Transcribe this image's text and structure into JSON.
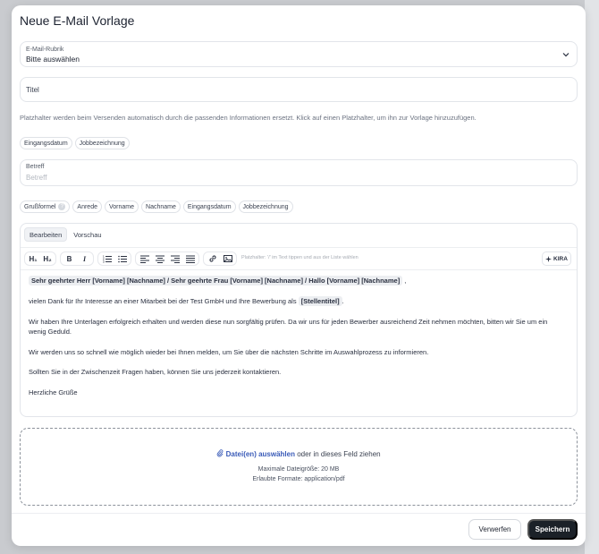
{
  "modal": {
    "title": "Neue E-Mail Vorlage"
  },
  "category": {
    "label": "E-Mail-Rubrik",
    "value": "Bitte auswählen"
  },
  "title_field": {
    "placeholder": "Titel"
  },
  "hint": "Platzhalter werden beim Versenden automatisch durch die passenden Informationen ersetzt. Klick auf einen Platzhalter, um ihn zur Vorlage hinzuzufügen.",
  "subject_placeholders": [
    "Eingangsdatum",
    "Jobbezeichnung"
  ],
  "subject": {
    "label": "Betreff",
    "placeholder": "Betreff"
  },
  "body_placeholders": {
    "greeting": "Grußformel",
    "greeting_help": "?",
    "items": [
      "Anrede",
      "Vorname",
      "Nachname",
      "Eingangsdatum",
      "Jobbezeichnung"
    ]
  },
  "editor": {
    "tabs": [
      "Bearbeiten",
      "Vorschau"
    ],
    "toolbar": {
      "h1": "H₁",
      "h2": "H₂",
      "bold": "B",
      "italic": "I",
      "placeholder_hint": "Platzhalter: '/' im Text tippen und aus der Liste wählen",
      "kira": "KIRA"
    },
    "content": {
      "salutation_token": "Sehr geehrter Herr [Vorname] [Nachname] / Sehr geehrte Frau [Vorname] [Nachname] / Hallo [Vorname] [Nachname]",
      "salutation_suffix": ",",
      "line1_prefix": "vielen Dank für Ihr Interesse an einer Mitarbeit bei der Test GmbH und Ihre Bewerbung als",
      "line1_token": "[Stellentitel]",
      "line1_suffix": ".",
      "para2": "Wir haben Ihre Unterlagen erfolgreich erhalten und werden diese nun sorgfältig prüfen. Da wir uns für jeden Bewerber ausreichend Zeit nehmen möchten, bitten wir Sie um ein wenig Geduld.",
      "para3": "Wir werden uns so schnell wie möglich wieder bei Ihnen melden, um Sie über die nächsten Schritte im Auswahlprozess zu informieren.",
      "para4": "Sollten Sie in der Zwischenzeit Fragen haben, können Sie uns jederzeit kontaktieren.",
      "closing": "Herzliche Grüße"
    }
  },
  "dropzone": {
    "link": "Datei(en) auswählen",
    "text": " oder in dieses Feld ziehen",
    "max_size": "Maximale Dateigröße: 20 MB",
    "formats": "Erlaubte Formate: application/pdf"
  },
  "footer": {
    "discard": "Verwerfen",
    "save": "Speichern"
  }
}
